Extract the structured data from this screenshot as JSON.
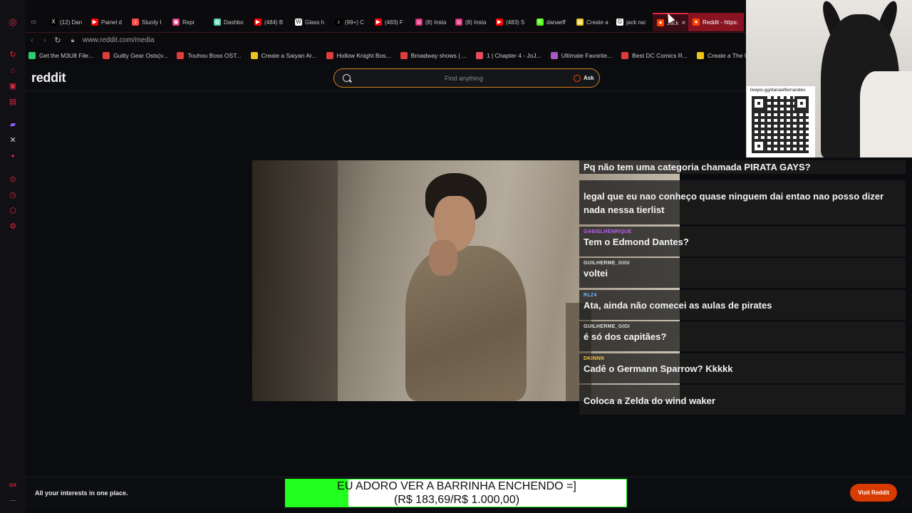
{
  "browser": {
    "tabs": [
      {
        "label": "(12) Dan",
        "icon": "x-icon",
        "color": "#000000"
      },
      {
        "label": "Painel d",
        "icon": "youtube-icon",
        "color": "#ff0000"
      },
      {
        "label": "Sturdy I",
        "icon": "music-icon",
        "color": "#ff4a4a"
      },
      {
        "label": "Repr",
        "icon": "audio-icon",
        "color": "#e83e8c"
      },
      {
        "label": "Dashbo",
        "icon": "globe-icon",
        "color": "#5ad1b6"
      },
      {
        "label": "(484) B",
        "icon": "youtube-icon",
        "color": "#ff0000"
      },
      {
        "label": "Glass h",
        "icon": "wikipedia-icon",
        "color": "#ffffff"
      },
      {
        "label": "(99+) C",
        "icon": "tiktok-icon",
        "color": "#000000"
      },
      {
        "label": "(483) F",
        "icon": "youtube-icon",
        "color": "#ff0000"
      },
      {
        "label": "(8) Insta",
        "icon": "instagram-icon",
        "color": "#d62976"
      },
      {
        "label": "(8) Insta",
        "icon": "instagram-icon",
        "color": "#d62976"
      },
      {
        "label": "(483) S",
        "icon": "youtube-icon",
        "color": "#ff0000"
      },
      {
        "label": "danaeff",
        "icon": "kick-icon",
        "color": "#53fc18"
      },
      {
        "label": "Create a",
        "icon": "tierlist-icon",
        "color": "#f0c419"
      },
      {
        "label": "jack rac",
        "icon": "google-icon",
        "color": "#ffffff"
      },
      {
        "label": "Jack",
        "icon": "reddit-icon",
        "color": "#ff4500"
      },
      {
        "label": "Reddit - https:",
        "icon": "reddit-icon",
        "color": "#ff4500"
      }
    ],
    "tab_close_glyph": "×",
    "url": "www.reddit.com/media",
    "bookmarks": [
      {
        "label": "Get the M3U8 File...",
        "color": "#2ecc71"
      },
      {
        "label": "Guilty Gear Osts(v...",
        "color": "#e03c3c"
      },
      {
        "label": "Touhou Boss OST...",
        "color": "#e03c3c"
      },
      {
        "label": "Create a Saiyan Ar...",
        "color": "#f0c419"
      },
      {
        "label": "Hollow Knight Bos...",
        "color": "#e03c3c"
      },
      {
        "label": "Broadway shows | ...",
        "color": "#e03c3c"
      },
      {
        "label": "1 | Chapter 4 - JoJ...",
        "color": "#e84a5f"
      },
      {
        "label": "Ultimate Favorite...",
        "color": "#a259c4"
      },
      {
        "label": "Best DC Comics R...",
        "color": "#e03c3c"
      },
      {
        "label": "Create a The Ulti...",
        "color": "#f0c419"
      }
    ],
    "sidebar_label": "GX"
  },
  "reddit": {
    "logo": "reddit",
    "search_placeholder": "Find anything",
    "ask_label": "Ask",
    "bottom_tagline": "All your interests in one place.",
    "visit_button": "Visit Reddit",
    "accent_color": "#ff4500"
  },
  "chat": [
    {
      "user": "",
      "user_color": "#c05cff",
      "text": "Pq não tem uma categoria chamada PIRATA GAYS?"
    },
    {
      "user": "",
      "user_color": "#c05cff",
      "text": "legal que eu nao conheço quase ninguem dai entao nao posso dizer nada nessa tierlist"
    },
    {
      "user": "GABIELHENRIQUE",
      "user_color": "#c05cff",
      "text": "Tem o Edmond Dantes?"
    },
    {
      "user": "GUILHERME_GIGI",
      "user_color": "#e0e0e0",
      "text": "voltei"
    },
    {
      "user": "RLZ4",
      "user_color": "#6fb7ff",
      "text": "Ata, ainda não comecei as aulas de pirates"
    },
    {
      "user": "GUILHERME_GIGI",
      "user_color": "#e0e0e0",
      "text": "é só dos capitães?"
    },
    {
      "user": "DKINNN",
      "user_color": "#f3c744",
      "text": "Cadê o Germann Sparrow? Kkkkk"
    },
    {
      "user": "",
      "user_color": "#ff3c7a",
      "text": "Coloca a Zelda do wind waker"
    }
  ],
  "webcam": {
    "qr_label": "livepix.gg/danaelfernandes"
  },
  "goal": {
    "line1": "EU ADORO VER A BARRINHA ENCHENDO =]",
    "line2": "(R$ 183,69/R$ 1.000,00)",
    "current": 183.69,
    "target": 1000.0,
    "fill_color": "#22ff1f"
  }
}
